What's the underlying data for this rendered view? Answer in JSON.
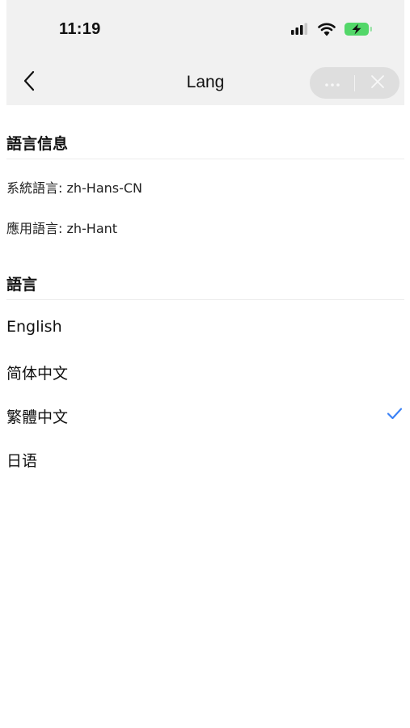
{
  "status_bar": {
    "time": "11:19",
    "icons": [
      "signal-icon",
      "wifi-icon",
      "battery-charging-icon"
    ]
  },
  "nav": {
    "back_icon": "chevron-left-icon",
    "title": "Lang",
    "more_icon": "more-dots-icon",
    "close_icon": "close-icon"
  },
  "info_section": {
    "title": "語言信息",
    "system_language": "系統語言: zh-Hans-CN",
    "app_language": "應用語言: zh-Hant"
  },
  "language_section": {
    "title": "語言",
    "items": [
      {
        "label": "English"
      },
      {
        "label": "简体中文"
      },
      {
        "label": "繁體中文"
      },
      {
        "label": "日语"
      }
    ],
    "selected_index": 2,
    "check_icon": "checkmark-icon"
  },
  "colors": {
    "accent": "#3b82f6",
    "nav_background": "#f1f1f1",
    "capsule_background": "#dedede"
  }
}
